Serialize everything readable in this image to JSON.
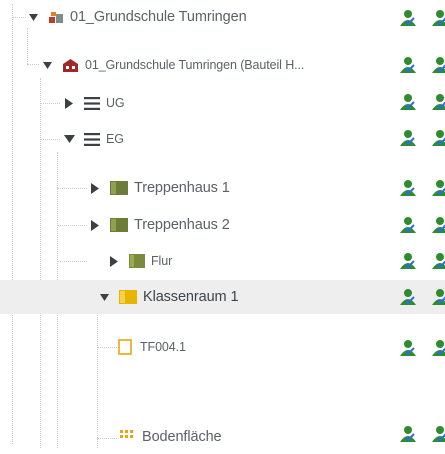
{
  "tree": {
    "nodes": [
      {
        "id": "school-site",
        "label": "01_Grundschule Tumringen",
        "expanded": true,
        "icon": "site-icon"
      },
      {
        "id": "building",
        "label": "01_Grundschule Tumringen (Bauteil H...",
        "expanded": true,
        "icon": "building-icon"
      },
      {
        "id": "floor-ug",
        "label": "UG",
        "expanded": false,
        "icon": "floor-icon"
      },
      {
        "id": "floor-eg",
        "label": "EG",
        "expanded": true,
        "icon": "floor-icon"
      },
      {
        "id": "room-treppenhaus-1",
        "label": "Treppenhaus 1",
        "expanded": false,
        "icon": "room-icon",
        "icon_color": "#6c7d3a"
      },
      {
        "id": "room-treppenhaus-2",
        "label": "Treppenhaus 2",
        "expanded": false,
        "icon": "room-icon",
        "icon_color": "#6c7d3a"
      },
      {
        "id": "room-flur",
        "label": "Flur",
        "expanded": false,
        "icon": "room-icon",
        "icon_color": "#7a8a3c"
      },
      {
        "id": "room-klassenraum-1",
        "label": "Klassenraum 1",
        "expanded": true,
        "icon": "room-icon",
        "icon_color": "#e8b400",
        "selected": true
      },
      {
        "id": "door-tf004",
        "label": "TF004.1",
        "icon": "door-icon",
        "icon_color": "#e8a317"
      },
      {
        "id": "floor-area",
        "label": "Bodenfläche",
        "icon": "floor-area-icon",
        "icon_color": "#e8a317"
      }
    ]
  },
  "status_column": {
    "icon": "status-person-icon",
    "colors": {
      "green": "#2e8b2e",
      "check": "#2a6fd6"
    }
  }
}
